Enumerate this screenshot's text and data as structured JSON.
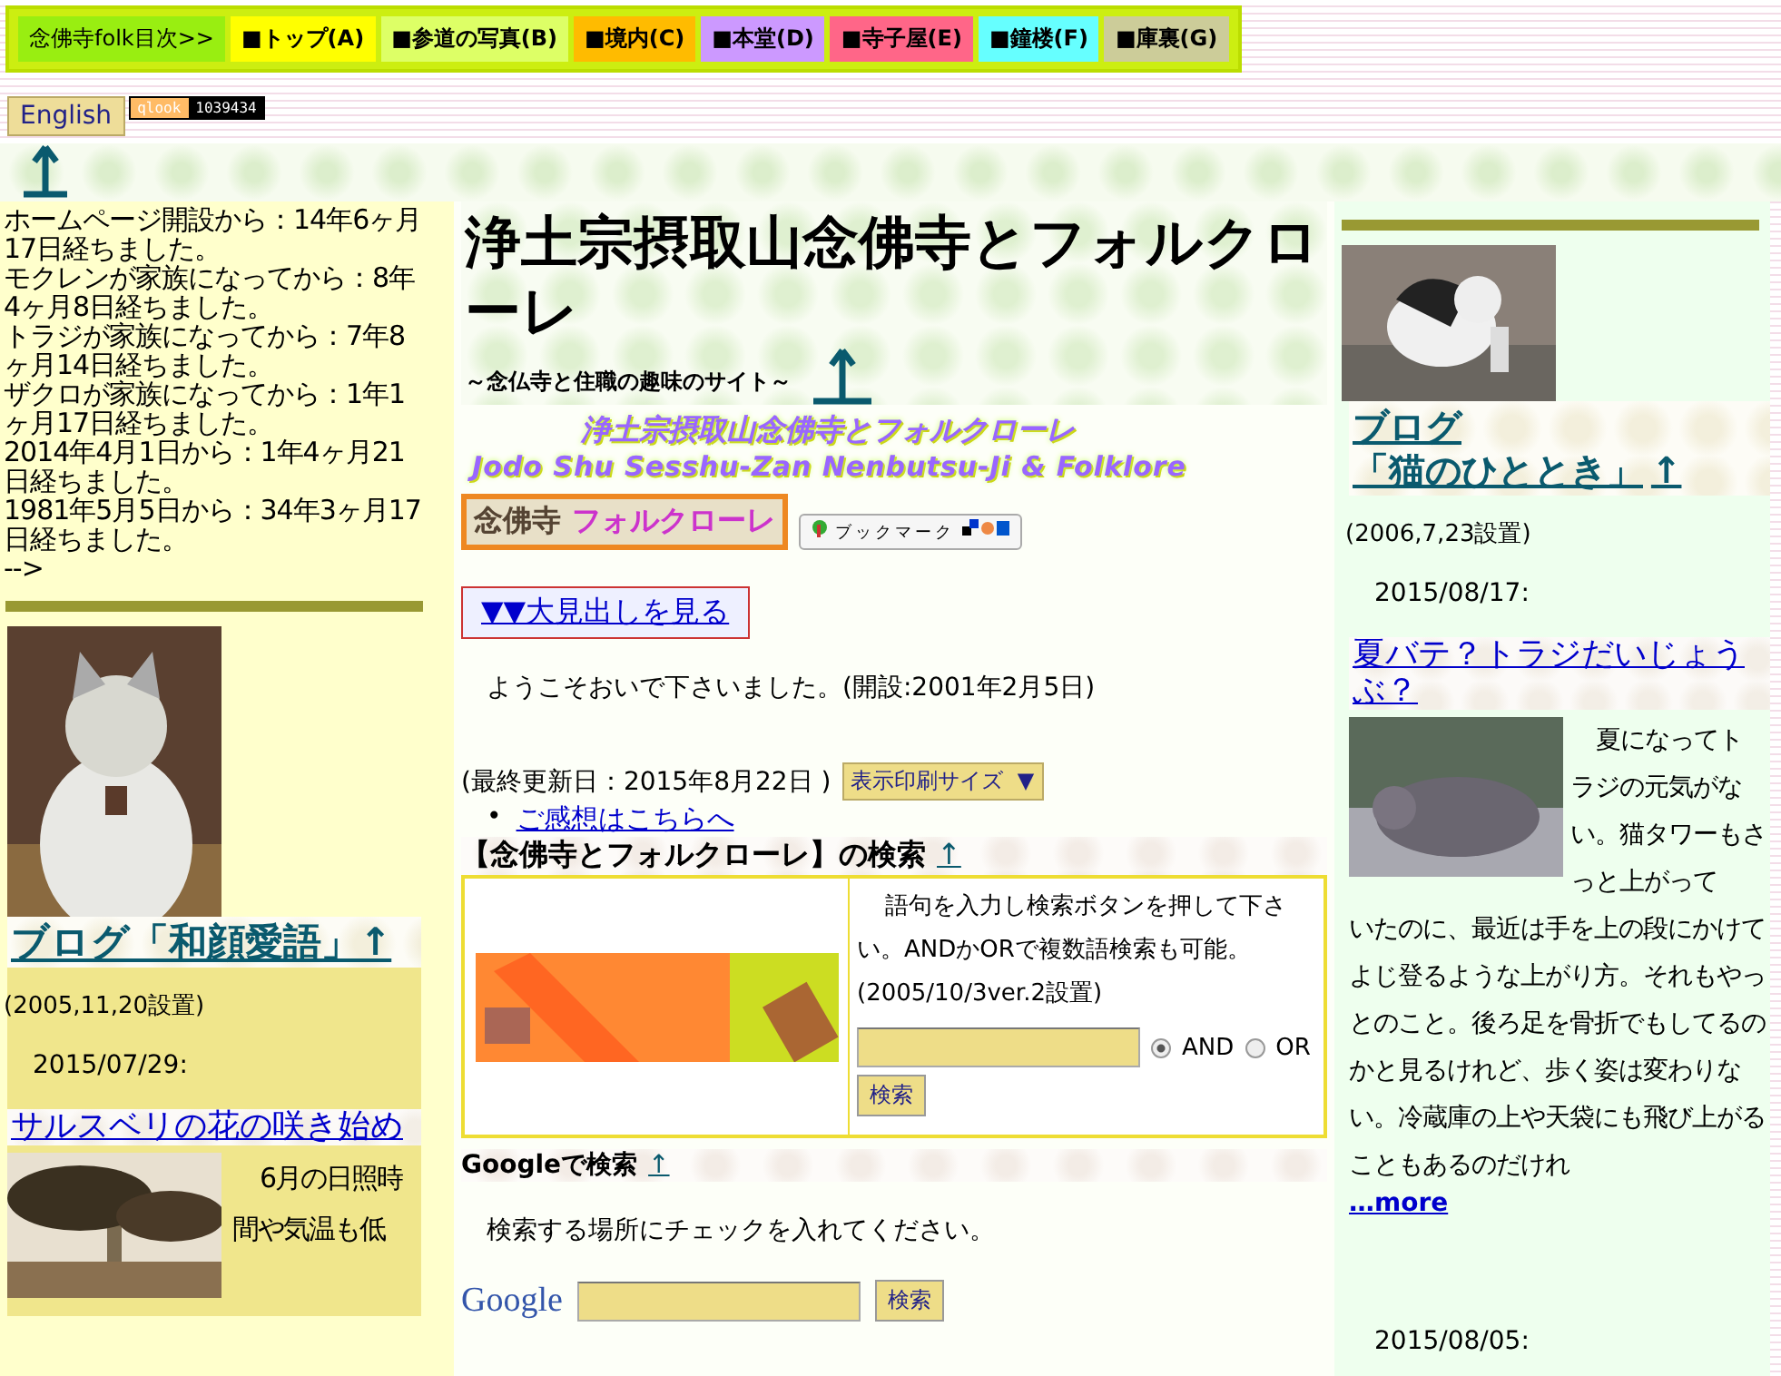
{
  "nav": {
    "items": [
      {
        "label": "念佛寺folk目次>>",
        "color": "#99ee11"
      },
      {
        "label": "■トップ(A)",
        "color": "#ffff00"
      },
      {
        "label": "■参道の写真(B)",
        "color": "#ddff66"
      },
      {
        "label": "■境内(C)",
        "color": "#ffbb00"
      },
      {
        "label": "■本堂(D)",
        "color": "#cc99ff"
      },
      {
        "label": "■寺子屋(E)",
        "color": "#ff6688"
      },
      {
        "label": "■鐘楼(F)",
        "color": "#66ffff"
      },
      {
        "label": "■庫裏(G)",
        "color": "#cccc99"
      }
    ]
  },
  "english_button": "English",
  "counter": {
    "brand": "qlook",
    "value": "1039434"
  },
  "left": {
    "elapsed": [
      "ホームページ開設から：14年6ヶ月17日経ちました。",
      "モクレンが家族になってから：8年4ヶ月8日経ちました。",
      "トラジが家族になってから：7年8ヶ月14日経ちました。",
      "ザクロが家族になってから：1年1ヶ月17日経ちました。",
      "2014年4月1日から：1年4ヶ月21日経ちました。",
      "1981年5月5日から：34年3ヶ月17日経ちました。",
      "-->"
    ],
    "blog": {
      "title": "ブログ「和顔愛語」",
      "arrow": "↑",
      "established": "(2005,11,20設置)",
      "date": "2015/07/29:",
      "post_title": "サルスベリの花の咲き始め",
      "excerpt": "6月の日照時間や気温も低"
    }
  },
  "center": {
    "title": "浄土宗摂取山念佛寺とフォルクローレ",
    "subtitle": "～念仏寺と住職の趣味のサイト～",
    "banner": {
      "line1": "浄土宗摂取山念佛寺とフォルクローレ",
      "line2": "Jodo Shu Sesshu-Zan Nenbutsu-Ji & Folklore"
    },
    "logo": {
      "part1": "念佛寺",
      "part2": "フォルクローレ"
    },
    "bookmark": "ブックマーク",
    "headlines_link": "▼▼大見出しを見る",
    "welcome": "ようこそおいで下さいました。(開設:2001年2月5日)",
    "updated": "(最終更新日：2015年8月22日 )",
    "size_select": "表示印刷サイズ",
    "size_caret": "▼",
    "feedback_bullet": "•",
    "feedback_link": "ご感想はこちらへ",
    "site_search": {
      "heading": "【念佛寺とフォルクローレ】の検索",
      "arrow": "↑",
      "instructions": "語句を入力し検索ボタンを押して下さい。ANDかORで複数語検索も可能。(2005/10/3ver.2設置)",
      "radios": [
        {
          "label": "AND",
          "selected": true
        },
        {
          "label": "OR",
          "selected": false
        }
      ],
      "button": "検索"
    },
    "google_search": {
      "heading": "Googleで検索",
      "arrow": "↑",
      "instructions": "検索する場所にチェックを入れてください。",
      "logo": "Google",
      "button": "検索"
    }
  },
  "right": {
    "blog": {
      "title_line1": "ブログ",
      "title_line2": "「猫のひととき」",
      "arrow": "↑",
      "established": "(2006,7,23設置)",
      "date": "2015/08/17:",
      "post_title": "夏バテ？トラジだいじょうぶ？",
      "excerpt": [
        "夏になってトラジの元気がない。猫タワーもさっと上がって",
        "いたのに、最近は手を上の段にかけてよじ登るような上がり方。それもやっとのこと。後ろ足を骨折でもしてるのかと見るけれど、歩く姿は変わりない。冷蔵庫の上や天袋にも飛び上がることもあるのだけれ"
      ],
      "more": "…more",
      "next_date": "2015/08/05:"
    }
  }
}
